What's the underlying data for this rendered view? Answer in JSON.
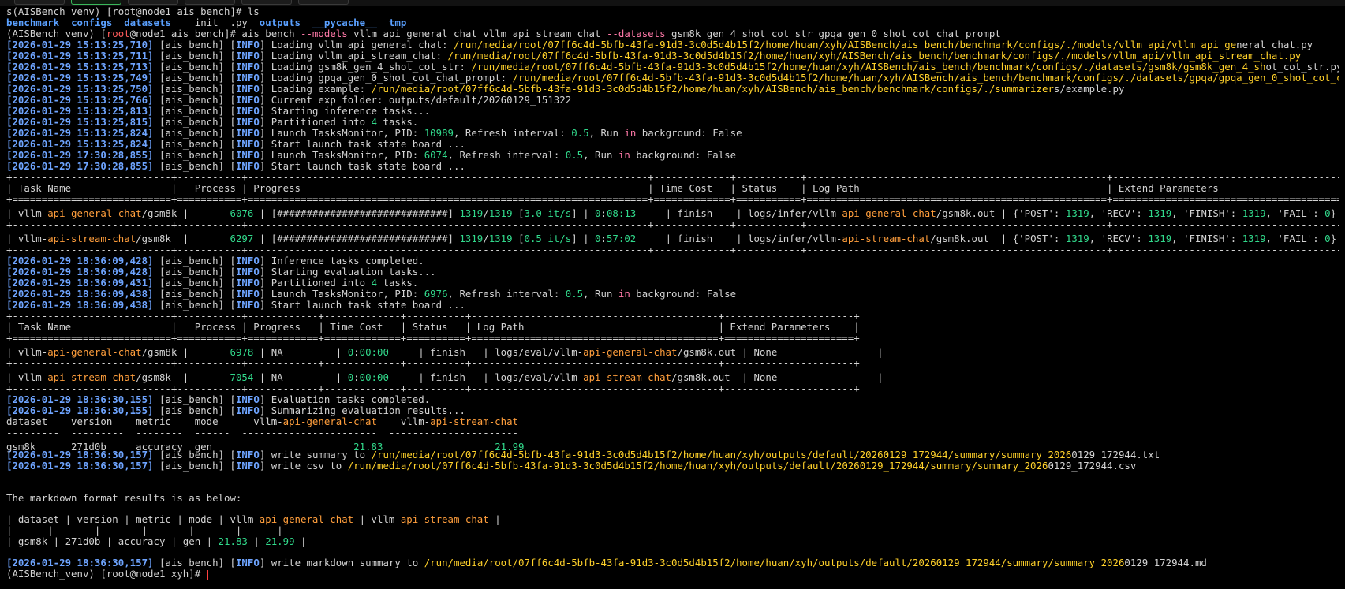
{
  "top_line": "s(AISBench_venv) [root@node1 ais_bench]# ls",
  "ls": {
    "dirs": [
      "benchmark",
      "configs",
      "datasets"
    ],
    "file": "__init__.py",
    "dirs2": [
      "outputs",
      "__pycache__",
      "tmp"
    ]
  },
  "cmd": {
    "prefix": "(AISBench_venv) [",
    "user": "root",
    "host": "@node1 ais_bench]# ais_bench ",
    "opt_models": "--models",
    "models": " vllm_api_general_chat vllm_api_stream_chat ",
    "opt_datasets": "--datasets",
    "datasets": " gsm8k_gen_4_shot_cot_str gpqa_gen_0_shot_cot_chat_prompt"
  },
  "log1": [
    {
      "ts": "2026-01-29 15:13:25,710",
      "msg": "Loading vllm_api_general_chat: ",
      "path": "/run/media/root/07ff6c4d-5bfb-43fa-91d3-3c0d5d4b15f2/home/huan/xyh/AISBench/ais_bench/benchmark/configs/./models/vllm_api/vllm_api_ge",
      "rest": "neral_chat.py"
    },
    {
      "ts": "2026-01-29 15:13:25,711",
      "msg": "Loading vllm_api_stream_chat: ",
      "path": "/run/media/root/07ff6c4d-5bfb-43fa-91d3-3c0d5d4b15f2/home/huan/xyh/AISBench/ais_bench/benchmark/configs/./models/vllm_api/vllm_api_stream_chat.py",
      "rest": ""
    },
    {
      "ts": "2026-01-29 15:13:25,713",
      "msg": "Loading gsm8k_gen_4_shot_cot_str: ",
      "path": "/run/media/root/07ff6c4d-5bfb-43fa-91d3-3c0d5d4b15f2/home/huan/xyh/AISBench/ais_bench/benchmark/configs/./datasets/gsm8k/gsm8k_gen_4_sh",
      "rest": "ot_cot_str.py"
    },
    {
      "ts": "2026-01-29 15:13:25,749",
      "msg": "Loading gpqa_gen_0_shot_cot_chat_prompt: ",
      "path": "/run/media/root/07ff6c4d-5bfb-43fa-91d3-3c0d5d4b15f2/home/huan/xyh/AISBench/ais_bench/benchmark/configs/./datasets/gpqa/gpqa_gen_0_shot_cot_c",
      "rest": "hat_prompt.py"
    },
    {
      "ts": "2026-01-29 15:13:25,750",
      "msg": "Loading example: ",
      "path": "/run/media/root/07ff6c4d-5bfb-43fa-91d3-3c0d5d4b15f2/home/huan/xyh/AISBench/ais_bench/benchmark/configs/./summarizer",
      "rest": "s/example.py"
    },
    {
      "ts": "2026-01-29 15:13:25,766",
      "msg": "Current exp folder: outputs/default/20260129_151322",
      "path": "",
      "rest": ""
    },
    {
      "ts": "2026-01-29 15:13:25,813",
      "msg": "Starting inference tasks...",
      "path": "",
      "rest": ""
    }
  ],
  "partition1": {
    "ts": "2026-01-29 15:13:25,815",
    "pre": "Partitioned into ",
    "n": "4",
    "post": " tasks."
  },
  "monitor1": {
    "ts": "2026-01-29 15:13:25,824",
    "pre": "Launch TasksMonitor, PID: ",
    "pid": "10989",
    "mid": ", Refresh interval: ",
    "interval": "0.5",
    "run": ", Run ",
    "in": "in",
    "post": " background: False"
  },
  "board1": {
    "ts": "2026-01-29 15:13:25,824",
    "msg": "Start launch task state board ..."
  },
  "monitor2": {
    "ts": "2026-01-29 17:30:28,855",
    "pre": "Launch TasksMonitor, PID: ",
    "pid": "6074",
    "mid": ", Refresh interval: ",
    "interval": "0.5",
    "run": ", Run ",
    "in": "in",
    "post": " background: False"
  },
  "board2": {
    "ts": "2026-01-29 17:30:28,855",
    "msg": "Start launch task state board ..."
  },
  "infer_table": {
    "border": "+---------------------------+-----------+--------------------------------------------------------------------+-------------+-----------+---------------------------------------------------+--------------------------------------------------------------------+",
    "header": "| Task Name                 |   Process | Progress                                                           | Time Cost   | Status    | Log Path                                          | Extend Parameters                                                  |",
    "sep": "+===========================+===========+====================================================================+=============+===========+===================================================+====================================================================+",
    "rows": [
      {
        "a": "| vllm-",
        "b": "api-general-chat",
        "c": "/gsm8k |       ",
        "pid": "6076",
        "d": " | [#############################] ",
        "done": "1319",
        "e": "/",
        "tot": "1319",
        "f": " [",
        "rate": "3.0 it/s",
        "g": "] | ",
        "h0": "0",
        "h1": ":",
        "tm": "08:13",
        "i": "     | finish    | logs/infer/vllm-",
        "lp": "api-general-chat",
        "j": "/gsm8k.out | {'POST': ",
        "p": "1319",
        "k": ", 'RECV': ",
        "r": "1319",
        "l": ", 'FINISH': ",
        "fi": "1319",
        "m": ", 'FAIL': ",
        "fa": "0",
        "n": "} |"
      },
      {
        "a": "| vllm-",
        "b": "api-stream-chat",
        "c": "/gsm8k  |       ",
        "pid": "6297",
        "d": " | [#############################] ",
        "done": "1319",
        "e": "/",
        "tot": "1319",
        "f": " [",
        "rate": "0.5 it/s",
        "g": "] | ",
        "h0": "0",
        "h1": ":",
        "tm": "57:02",
        "i": "     | finish    | logs/infer/vllm-",
        "lp": "api-stream-chat",
        "j": "/gsm8k.out  | {'POST': ",
        "p": "1319",
        "k": ", 'RECV': ",
        "r": "1319",
        "l": ", 'FINISH': ",
        "fi": "1319",
        "m": ", 'FAIL': ",
        "fa": "0",
        "n": "} |"
      }
    ]
  },
  "log2": [
    {
      "ts": "2026-01-29 18:36:09,428",
      "msg": "Inference tasks completed."
    },
    {
      "ts": "2026-01-29 18:36:09,428",
      "msg": "Starting evaluation tasks..."
    }
  ],
  "partition2": {
    "ts": "2026-01-29 18:36:09,431",
    "pre": "Partitioned into ",
    "n": "4",
    "post": " tasks."
  },
  "monitor3": {
    "ts": "2026-01-29 18:36:09,438",
    "pre": "Launch TasksMonitor, PID: ",
    "pid": "6976",
    "mid": ", Refresh interval: ",
    "interval": "0.5",
    "run": ", Run ",
    "in": "in",
    "post": " background: False"
  },
  "board3": {
    "ts": "2026-01-29 18:36:09,438",
    "msg": "Start launch task state board ..."
  },
  "eval_table": {
    "border": "+---------------------------+-----------+------------+-------------+----------+------------------------------------------+----------------------+",
    "header": "| Task Name                 |   Process | Progress   | Time Cost   | Status   | Log Path                                 | Extend Parameters    |",
    "sep": "+===========================+===========+============+=============+==========+==========================================+======================+",
    "rows": [
      {
        "a": "| vllm-",
        "b": "api-general-chat",
        "c": "/gsm8k |       ",
        "pid": "6978",
        "d": " | NA         | ",
        "h0": "0",
        "h1": ":",
        "tm": "00:00",
        "i": "     | finish   | logs/eval/vllm-",
        "lp": "api-general-chat",
        "j": "/gsm8k.out | None                 |"
      },
      {
        "a": "| vllm-",
        "b": "api-stream-chat",
        "c": "/gsm8k  |       ",
        "pid": "7054",
        "d": " | NA         | ",
        "h0": "0",
        "h1": ":",
        "tm": "00:00",
        "i": "     | finish   | logs/eval/vllm-",
        "lp": "api-stream-chat",
        "j": "/gsm8k.out  | None                 |"
      }
    ]
  },
  "log3": [
    {
      "ts": "2026-01-29 18:36:30,155",
      "msg": "Evaluation tasks completed."
    },
    {
      "ts": "2026-01-29 18:36:30,155",
      "msg": "Summarizing evaluation results..."
    }
  ],
  "summary": {
    "header_pre": "dataset    version    metric    mode      vllm-",
    "h1": "api-general-chat",
    "header_mid": "    vllm-",
    "h2": "api-stream-chat",
    "dashes": "---------  ---------  --------  ------  -----------------------  ----------------------",
    "row_pre": "gsm8k      271d0b     accuracy  gen                        ",
    "v1": "21.83",
    "row_mid": "                   ",
    "v2": "21.99"
  },
  "write1": {
    "ts": "2026-01-29 18:36:30,157",
    "pre": "write summary to ",
    "path": "/run/media/root/07ff6c4d-5bfb-43fa-91d3-3c0d5d4b15f2/home/huan/xyh/outputs/default/20260129_172944/summary/summary_2026",
    "rest": "0129_172944.txt"
  },
  "write2": {
    "ts": "2026-01-29 18:36:30,157",
    "pre": "write csv to ",
    "path": "/run/media/root/07ff6c4d-5bfb-43fa-91d3-3c0d5d4b15f2/home/huan/xyh/outputs/default/20260129_172944/summary/summary_2026",
    "rest": "0129_172944.csv"
  },
  "md_intro": "The markdown format results is as below:",
  "md": {
    "header_pre": "| dataset | version | metric | mode | vllm-",
    "h1": "api-general-chat",
    "header_mid": " | vllm-",
    "h2": "api-stream-chat",
    "header_end": " |",
    "sep": "|----- | ----- | ----- | ----- | ----- | -----|",
    "row_pre": "| gsm8k | 271d0b | accuracy | gen | ",
    "v1": "21.83",
    "row_mid": " | ",
    "v2": "21.99",
    "row_end": " |"
  },
  "write3": {
    "ts": "2026-01-29 18:36:30,157",
    "pre": "write markdown summary to ",
    "path": "/run/media/root/07ff6c4d-5bfb-43fa-91d3-3c0d5d4b15f2/home/huan/xyh/outputs/default/20260129_172944/summary/summary_2026",
    "rest": "0129_172944.md"
  },
  "final_prompt": "(AISBench_venv) [root@node1 xyh]# ",
  "tags": {
    "logger": "ais_bench",
    "level": "INFO"
  },
  "colors": {
    "bg": "#000000",
    "text": "#d3d3d3",
    "blue": "#6ea4ff",
    "red": "#ff5b5b",
    "pink": "#ff79a8",
    "yellow": "#ffd12a",
    "green": "#31d98b",
    "orange": "#ff9e3c"
  }
}
